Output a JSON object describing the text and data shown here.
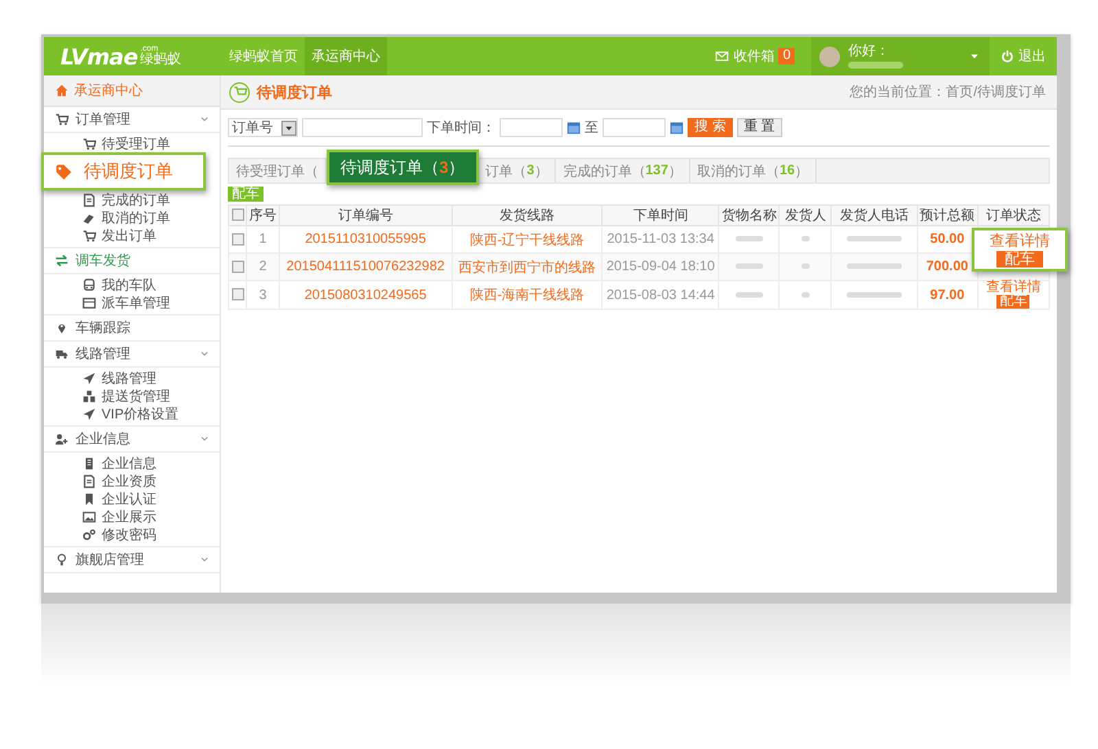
{
  "header": {
    "logo": "LVmae",
    "logo_domain": ".com",
    "logo_cn": "绿蚂蚁",
    "nav": [
      {
        "label": "绿蚂蚁首页",
        "selected": false
      },
      {
        "label": "承运商中心",
        "selected": true
      }
    ],
    "inbox": {
      "label": "收件箱",
      "count": "0"
    },
    "user": {
      "greeting": "你好：",
      "name_redacted": true
    },
    "logout": "退出"
  },
  "sidebar": {
    "home": "承运商中心",
    "groups": [
      {
        "label": "订单管理",
        "collapsible": true,
        "active": false,
        "items": [
          {
            "kind": "item",
            "label": "待受理订单"
          },
          {
            "kind": "callout",
            "label": "待调度订单"
          },
          {
            "kind": "item",
            "label": "完成的订单"
          },
          {
            "kind": "item",
            "label": "取消的订单"
          },
          {
            "kind": "item",
            "label": "发出订单"
          }
        ]
      },
      {
        "label": "调车发货",
        "collapsible": false,
        "active": true,
        "items": [
          {
            "kind": "item",
            "label": "我的车队"
          },
          {
            "kind": "item",
            "label": "派车单管理"
          }
        ]
      },
      {
        "label": "车辆跟踪",
        "collapsible": false,
        "active": false
      },
      {
        "label": "线路管理",
        "collapsible": true,
        "active": false,
        "items": [
          {
            "kind": "item",
            "label": "线路管理"
          },
          {
            "kind": "item",
            "label": "提送货管理"
          },
          {
            "kind": "item",
            "label": "VIP价格设置"
          }
        ]
      },
      {
        "label": "企业信息",
        "collapsible": true,
        "active": false,
        "items": [
          {
            "kind": "item",
            "label": "企业信息"
          },
          {
            "kind": "item",
            "label": "企业资质"
          },
          {
            "kind": "item",
            "label": "企业认证"
          },
          {
            "kind": "item",
            "label": "企业展示"
          },
          {
            "kind": "item",
            "label": "修改密码"
          }
        ]
      },
      {
        "label": "旗舰店管理",
        "collapsible": true,
        "active": false
      }
    ]
  },
  "page": {
    "title": "待调度订单",
    "breadcrumb": "您的当前位置：首页/待调度订单"
  },
  "search": {
    "select": "订单号",
    "time_label": "下单时间：",
    "to": "至",
    "search_button": "搜 索",
    "reset_button": "重 置"
  },
  "tabs": [
    {
      "kind": "tab",
      "label": "待受理订单（",
      "selected": false
    },
    {
      "kind": "callout",
      "label": "待调度订单（",
      "count": "3",
      "close": "）",
      "selected": true
    },
    {
      "kind": "tab",
      "label": "订单（",
      "count": "3",
      "close": "）",
      "selected": false
    },
    {
      "kind": "tab",
      "label": "完成的订单（",
      "count": "137",
      "close": "）",
      "selected": false
    },
    {
      "kind": "tab",
      "label": "取消的订单（",
      "count": "16",
      "close": "）",
      "selected": false
    }
  ],
  "assign_button": "配车",
  "table": {
    "select_all_checked": false,
    "columns": [
      "序号",
      "订单编号",
      "发货线路",
      "下单时间",
      "货物名称",
      "发货人",
      "发货人电话",
      "预计总额",
      "订单状态"
    ],
    "rows": [
      {
        "checked": false,
        "index": "1",
        "order_no": "2015110310055995",
        "route": "陕西-辽宁干线线路",
        "time": "2015-11-03 13:34",
        "redacted": true,
        "total": "50.00",
        "callout": {
          "link": "查看详情",
          "button": "配车"
        }
      },
      {
        "checked": false,
        "index": "2",
        "order_no": "201504111510076232982",
        "route": "西安市到西宁市的线路",
        "time": "2015-09-04 18:10",
        "redacted": true,
        "total": "700.00"
      },
      {
        "checked": false,
        "index": "3",
        "order_no": "2015080310249565",
        "route": "陕西-海南干线线路",
        "time": "2015-08-03 14:44",
        "redacted": true,
        "total": "97.00",
        "actions": [
          {
            "kind": "link",
            "label": "查看详情"
          },
          {
            "kind": "button",
            "label": "配车"
          }
        ]
      }
    ]
  }
}
